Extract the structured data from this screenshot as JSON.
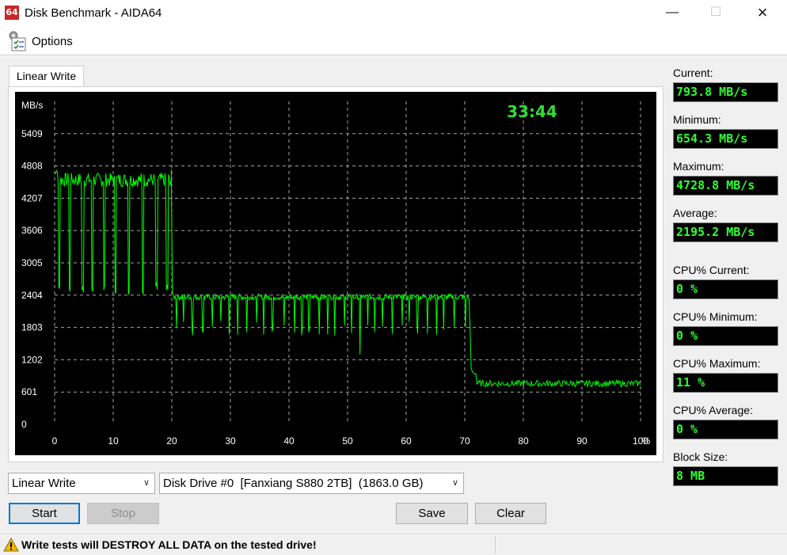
{
  "window": {
    "app_icon_text": "64",
    "title": "Disk Benchmark - AIDA64"
  },
  "menu": {
    "options_label": "Options"
  },
  "tab": {
    "label": "Linear Write"
  },
  "chart_data": {
    "type": "line",
    "ylabel": "MB/s",
    "y_ticks": [
      "0",
      "601",
      "1202",
      "1803",
      "2404",
      "3005",
      "3606",
      "4207",
      "4808",
      "5409"
    ],
    "x_ticks": [
      "0",
      "10",
      "20",
      "30",
      "40",
      "50",
      "60",
      "70",
      "80",
      "90",
      "100"
    ],
    "x_unit": "%",
    "ylim": [
      0,
      6010
    ],
    "xlim": [
      0,
      100
    ],
    "grid": true,
    "elapsed": "33:44",
    "colors": {
      "line": "#00ff00",
      "background": "#000000",
      "grid": "#d0d0d0",
      "elapsed": "#33dd33"
    },
    "series": [
      {
        "segments": [
          {
            "x_range": [
              0,
              20
            ],
            "baseline": 4550,
            "dips": [
              0.8,
              2.6,
              4.8,
              6.4,
              8.5,
              10.4,
              12.7,
              15.1,
              17.4,
              19.2
            ],
            "dip_min": 2400
          },
          {
            "x_range": [
              20.2,
              70.8
            ],
            "baseline": 2370,
            "dips_every": 1.6,
            "dip_min": 1650
          },
          {
            "x_range": [
              71.3,
              100
            ],
            "baseline": 760
          }
        ],
        "current": 793.8,
        "minimum": 654.3,
        "maximum": 4728.8,
        "average": 2195.2
      }
    ]
  },
  "stats": {
    "current_label": "Current:",
    "current_value": "793.8 MB/s",
    "minimum_label": "Minimum:",
    "minimum_value": "654.3 MB/s",
    "maximum_label": "Maximum:",
    "maximum_value": "4728.8 MB/s",
    "average_label": "Average:",
    "average_value": "2195.2 MB/s",
    "cpu_current_label": "CPU% Current:",
    "cpu_current_value": "0 %",
    "cpu_minimum_label": "CPU% Minimum:",
    "cpu_minimum_value": "0 %",
    "cpu_maximum_label": "CPU% Maximum:",
    "cpu_maximum_value": "11 %",
    "cpu_average_label": "CPU% Average:",
    "cpu_average_value": "0 %",
    "block_size_label": "Block Size:",
    "block_size_value": "8 MB"
  },
  "controls": {
    "test_select": "Linear Write",
    "drive_select": "Disk Drive #0  [Fanxiang S880 2TB]  (1863.0 GB)",
    "start_label": "Start",
    "stop_label": "Stop",
    "save_label": "Save",
    "clear_label": "Clear"
  },
  "status": {
    "warning_text": "Write tests will DESTROY ALL DATA on the tested drive!"
  },
  "icons": {
    "app": "aida64-logo-icon",
    "options": "options-checklist-icon",
    "warning": "warning-triangle-icon",
    "dropdown": "chevron-down-icon"
  }
}
